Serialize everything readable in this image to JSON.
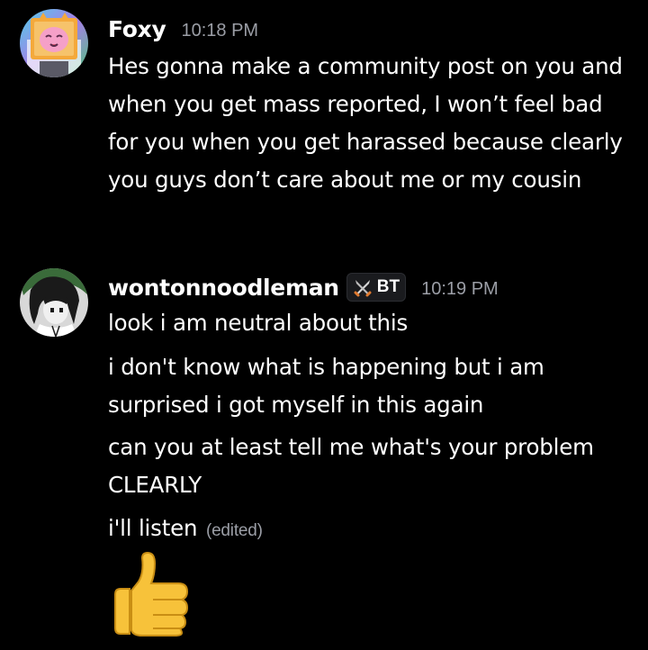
{
  "messages": [
    {
      "author": "Foxy",
      "timestamp": "10:18 PM",
      "avatar_icon": "pink-cat-in-orange-box-avatar",
      "text": "Hes gonna make a community post on you and when you get mass reported, I won’t feel bad for you when you get harassed because clearly you guys don’t care about me or my cousin"
    },
    {
      "author": "wontonnoodleman",
      "tag": {
        "icon": "crossed-swords-icon",
        "label": "BT"
      },
      "timestamp": "10:19 PM",
      "avatar_icon": "anime-character-avatar",
      "lines": [
        "look i am neutral about this",
        "i don't know what is happening but i am surprised i got myself in this again",
        "can you at least tell me what's your problem CLEARLY",
        "i'll listen"
      ],
      "edited_label": "(edited)",
      "emoji": "thumbs-up-icon"
    }
  ],
  "colors": {
    "background": "#000000",
    "text": "#ffffff",
    "muted": "#9b9ea6"
  }
}
